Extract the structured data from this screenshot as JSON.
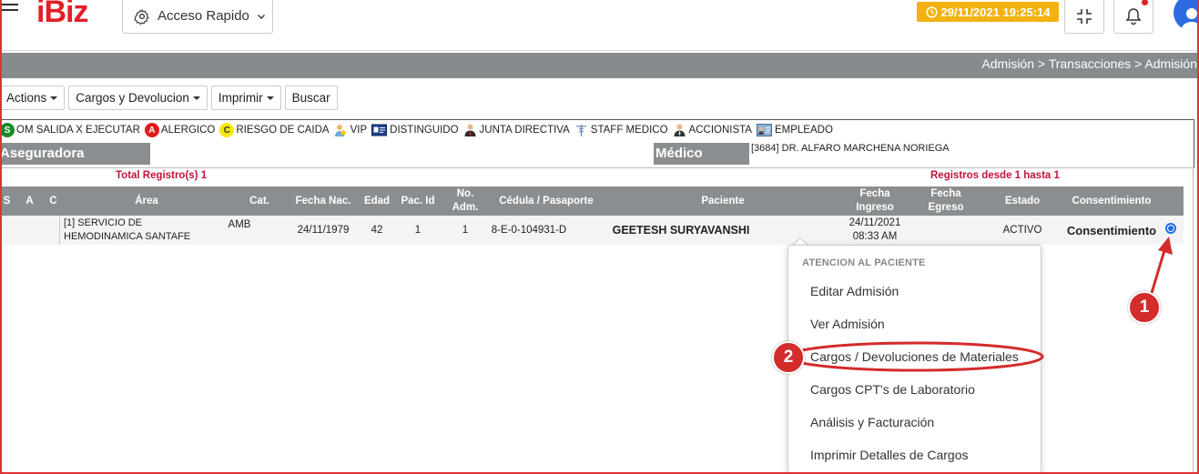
{
  "header": {
    "logo": "iBiz",
    "quick_access": "Acceso Rapido",
    "datetime": "29/11/2021 19:25:14"
  },
  "breadcrumb": "Admisión > Transacciones > Admisión",
  "toolbar": {
    "actions": "Actions",
    "cargos": "Cargos y Devolucion",
    "imprimir": "Imprimir",
    "buscar": "Buscar"
  },
  "legend": {
    "s_letter": "S",
    "s_label": "OM SALIDA X EJECUTAR",
    "a_letter": "A",
    "a_label": "ALERGICO",
    "c_letter": "C",
    "c_label": "RIESGO DE CAIDA",
    "vip": "VIP",
    "distinguido": "DISTINGUIDO",
    "junta": "JUNTA DIRECTIVA",
    "staff": "STAFF MEDICO",
    "accionista": "ACCIONISTA",
    "empleado": "EMPLEADO",
    "colors": {
      "s": "#1a8a2a",
      "a": "#e01b1b",
      "c": "#f5e90c"
    }
  },
  "info": {
    "aseguradora_label": "Aseguradora",
    "medico_label": "Médico",
    "medico_value": "[3684] DR. ALFARO MARCHENA NORIEGA"
  },
  "table": {
    "total": "Total Registro(s) 1",
    "range": "Registros desde 1 hasta 1",
    "headers": {
      "s": "S",
      "a": "A",
      "c": "C",
      "area": "Área",
      "cat": "Cat.",
      "fecha_nac": "Fecha Nac.",
      "edad": "Edad",
      "pac_id": "Pac. Id",
      "no_adm_1": "No.",
      "no_adm_2": "Adm.",
      "cedula": "Cédula / Pasaporte",
      "paciente": "Paciente",
      "fecha_ingreso_1": "Fecha",
      "fecha_ingreso_2": "Ingreso",
      "fecha_egreso_1": "Fecha",
      "fecha_egreso_2": "Egreso",
      "estado": "Estado",
      "consentimiento": "Consentimiento"
    },
    "row": {
      "area_1": "[1] SERVICIO DE",
      "area_2": "HEMODINAMICA SANTAFE",
      "cat": "AMB",
      "fecha_nac": "24/11/1979",
      "edad": "42",
      "pac_id": "1",
      "no_adm": "1",
      "cedula": "8-E-0-104931-D",
      "paciente": "GEETESH SURYAVANSHI",
      "fecha_ingreso_1": "24/11/2021",
      "fecha_ingreso_2": "08:33 AM",
      "estado": "ACTIVO",
      "consentimiento": "Consentimiento"
    }
  },
  "popup": {
    "heading": "ATENCION AL PACIENTE",
    "items": [
      "Editar Admisión",
      "Ver Admisión",
      "Cargos / Devoluciones de Materiales",
      "Cargos CPT's de Laboratorio",
      "Análisis y Facturación",
      "Imprimir Detalles de Cargos"
    ]
  },
  "annotations": {
    "marker_1": "1",
    "marker_2": "2",
    "color": "#d42b2b"
  }
}
